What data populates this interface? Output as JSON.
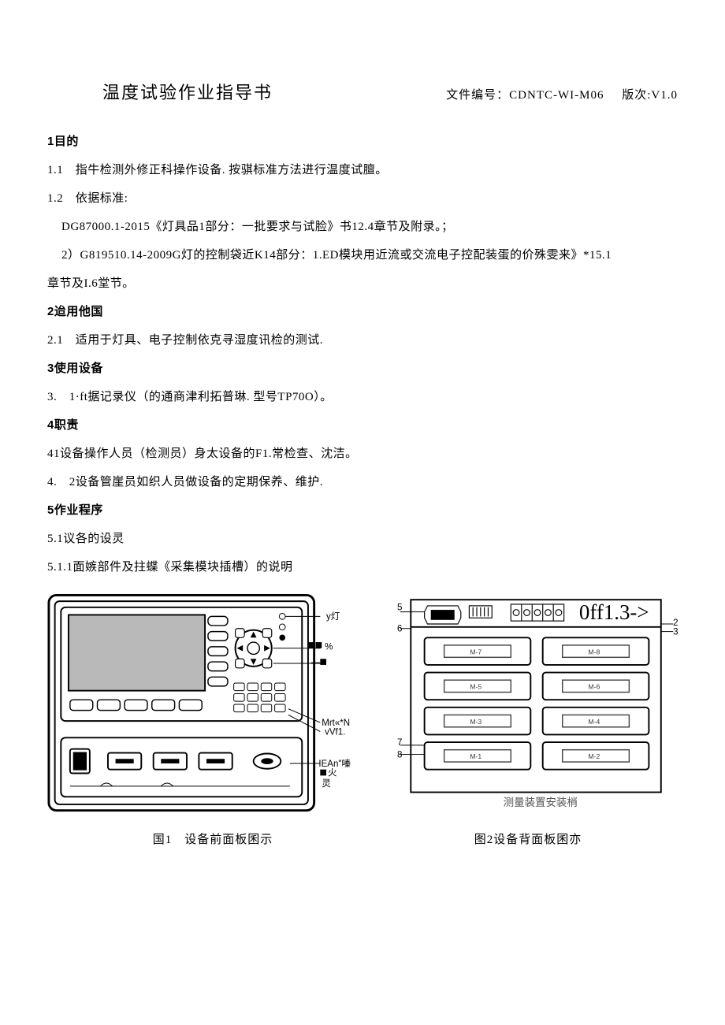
{
  "header": {
    "title": "温度试验作业指导书",
    "doc_num_label": "文件编号：",
    "doc_num": "CDNTC-WI-M06",
    "version_label": "版次:",
    "version": "V1.0"
  },
  "sections": {
    "s1": {
      "h": "1目的"
    },
    "s1_1": "1.1 指牛检测外修正科操作设备. 按骐标准方法进行温度试膻。",
    "s1_2": "1.2 依据标准:",
    "s1_2a": "DG87000.1-2015《灯具品1部分：一批要求与试脸》书12.4章节及附录。；",
    "s1_2b": "2）G819510.14-2009G灯的控制袋近K14部分：1.ED模块用近流或交流电子控配装蛋的价殊雯来》*15.1",
    "s1_2c": "章节及I.6堂节。",
    "s2": {
      "h": "2迨用他国"
    },
    "s2_1": "2.1 适用于灯具、电子控制依克寻湿度讯检的测试.",
    "s3": {
      "h": "3使用设备"
    },
    "s3_1": "3. 1·ft据记录仪（的通商津利拓普琳. 型号TP70O）。",
    "s4": {
      "h": "4职责"
    },
    "s4_1": "41设备操作人员（检测员）身太设备的F1.常检查、沈洁。",
    "s4_2": "4. 2设备管崖员如织人员做设备的定期保养、维护.",
    "s5": {
      "h": "5作业程序"
    },
    "s5_1": "5.1议各的设灵",
    "s5_1_1": "5.1.1面嫉部件及拄蝶《采集模块插槽）的说明"
  },
  "figures": {
    "fig1": {
      "caption": "国1 设备前面板囷示",
      "annot_ydeng": "y灯",
      "annot_pct": "%",
      "annot_mrt": "Mrt«*N",
      "annot_vvf": "vVf1.",
      "annot_iean": "IEAn\"嗪",
      "annot_huo": "火",
      "annot_ling": "灵"
    },
    "fig2": {
      "caption": "图2设备背面板囷亦",
      "top_label": "0ff1.3->",
      "bottom_label": "测量装置安装梢",
      "left_nums": {
        "n5": "5",
        "n6": "6",
        "n7": "7",
        "n8": "8"
      },
      "right_nums": {
        "n2": "2",
        "n3": "3"
      },
      "slots": {
        "m1": "M-1",
        "m2": "M-2",
        "m3": "M-3",
        "m4": "M-4",
        "m5": "M-5",
        "m6": "M-6",
        "m7": "M-7",
        "m8": "M-8"
      }
    }
  }
}
